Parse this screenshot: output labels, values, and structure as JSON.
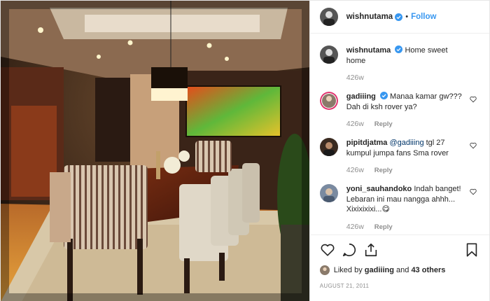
{
  "header": {
    "username": "wishnutama",
    "separator": "•",
    "follow_label": "Follow"
  },
  "comments": [
    {
      "username": "wishnutama",
      "text": "Home sweet home",
      "age": "426w",
      "reply": ""
    },
    {
      "username": "gadiiing",
      "text": "Manaa kamar gw??? Dah di ksh rover ya?",
      "age": "426w",
      "reply": "Reply"
    },
    {
      "username": "pipitdjatma",
      "mention": "@gadiiing",
      "text": " tgl 27 kumpul jumpa fans Sma rover",
      "age": "426w",
      "reply": "Reply"
    },
    {
      "username": "yoni_sauhandoko",
      "text": "Indah banget! Lebaran ini mau nangga ahhh... Xixixixixi...😋",
      "age": "426w",
      "reply": "Reply"
    }
  ],
  "actions": {
    "liked_by_prefix": "Liked by",
    "liked_by_user": "gadiiing",
    "and": "and",
    "others": "43 others",
    "date": "AUGUST 21, 2011"
  },
  "colors": {
    "accent": "#3897f0",
    "verified": "#3897f0",
    "text": "#262626",
    "muted": "#8e8e8e"
  },
  "icons": [
    "heart-icon",
    "comment-icon",
    "share-icon",
    "bookmark-icon",
    "verified-icon"
  ]
}
